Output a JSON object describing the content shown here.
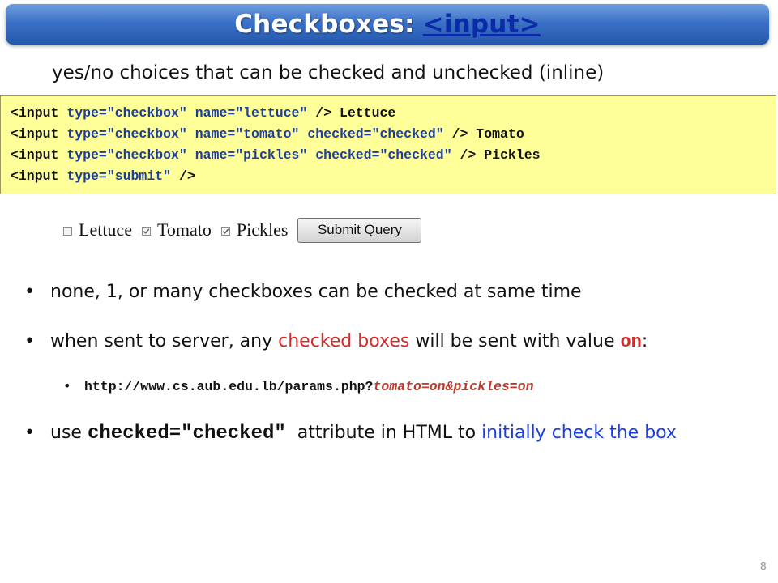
{
  "title": {
    "text": "Checkboxes:",
    "link": "<input>"
  },
  "subtitle": "yes/no choices that can be checked and unchecked (inline)",
  "code": {
    "lines": [
      {
        "open": "<input ",
        "attrs": "type=\"checkbox\" name=\"lettuce\"",
        "close": " /> Lettuce"
      },
      {
        "open": "<input ",
        "attrs": "type=\"checkbox\" name=\"tomato\" checked=\"checked\"",
        "close": " /> Tomato"
      },
      {
        "open": "<input ",
        "attrs": "type=\"checkbox\" name=\"pickles\" checked=\"checked\"",
        "close": " /> Pickles"
      },
      {
        "open": "<input ",
        "attrs": "type=\"submit\"",
        "close": " />"
      }
    ]
  },
  "demo": {
    "checkboxes": [
      {
        "label": "Lettuce",
        "checked": false
      },
      {
        "label": "Tomato",
        "checked": true
      },
      {
        "label": "Pickles",
        "checked": true
      }
    ],
    "submit_label": "Submit Query"
  },
  "bullets": {
    "b1": "none, 1, or many checkboxes can be checked at same time",
    "b2": {
      "pre": "when sent to server, any ",
      "highlight": "checked boxes",
      "mid": " will be sent with value ",
      "code": "on",
      "post": ":"
    },
    "b3": {
      "base": "http://www.cs.aub.edu.lb/params.php?",
      "query": "tomato=on&pickles=on"
    },
    "b4": {
      "pre": "use ",
      "code": "checked=\"checked\"",
      "mid": "  attribute in HTML to ",
      "highlight": "initially check the box"
    }
  },
  "page_number": "8",
  "colors": {
    "title_bar": "#3b71c6",
    "code_bg": "#ffff99",
    "red": "#d42a2a",
    "blue": "#1a3fe0"
  }
}
